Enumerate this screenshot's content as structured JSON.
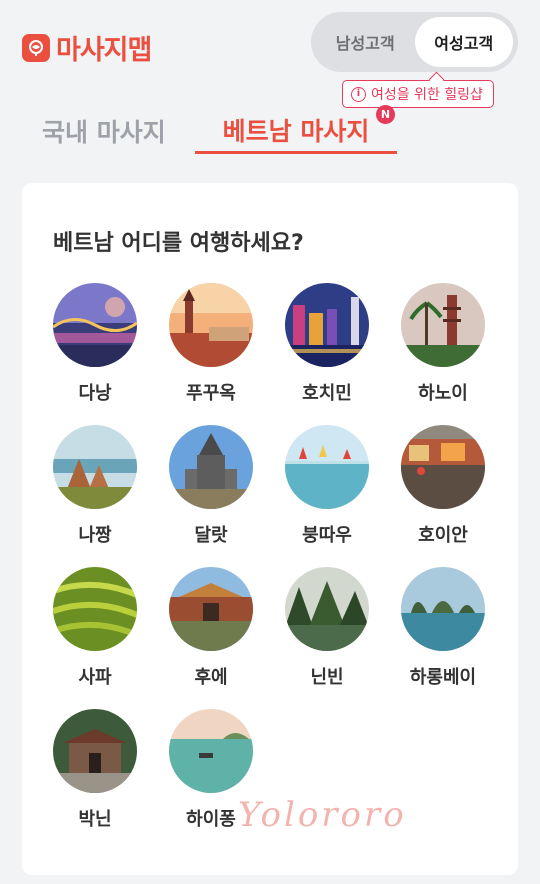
{
  "brand": {
    "name": "마사지맵",
    "accent": "#ea4f3f"
  },
  "gender_toggle": {
    "male_label": "남성고객",
    "female_label": "여성고객",
    "selected": "female"
  },
  "tooltip": {
    "icon": "info-icon",
    "text": "여성을 위한 힐링샵",
    "color": "#e63a5a"
  },
  "tabs": [
    {
      "label": "국내 마사지",
      "active": false
    },
    {
      "label": "베트남 마사지",
      "active": true,
      "badge": "N"
    }
  ],
  "section": {
    "title": "베트남 어디를 여행하세요?"
  },
  "cities": [
    {
      "name": "다낭",
      "photo": "dragon-bridge-night"
    },
    {
      "name": "푸꾸옥",
      "photo": "clock-tower-sunset"
    },
    {
      "name": "호치민",
      "photo": "city-skyline-night"
    },
    {
      "name": "하노이",
      "photo": "pagoda-palm"
    },
    {
      "name": "나짱",
      "photo": "cham-towers"
    },
    {
      "name": "달랏",
      "photo": "ornate-pagoda"
    },
    {
      "name": "붕따우",
      "photo": "lake-boats"
    },
    {
      "name": "호이안",
      "photo": "old-town-river"
    },
    {
      "name": "사파",
      "photo": "rice-terraces"
    },
    {
      "name": "후에",
      "photo": "imperial-gate"
    },
    {
      "name": "닌빈",
      "photo": "karst-river"
    },
    {
      "name": "하롱베이",
      "photo": "limestone-islands"
    },
    {
      "name": "박닌",
      "photo": "temple-gate"
    },
    {
      "name": "하이퐁",
      "photo": "bay-boat"
    }
  ],
  "watermark": "Yolororo"
}
